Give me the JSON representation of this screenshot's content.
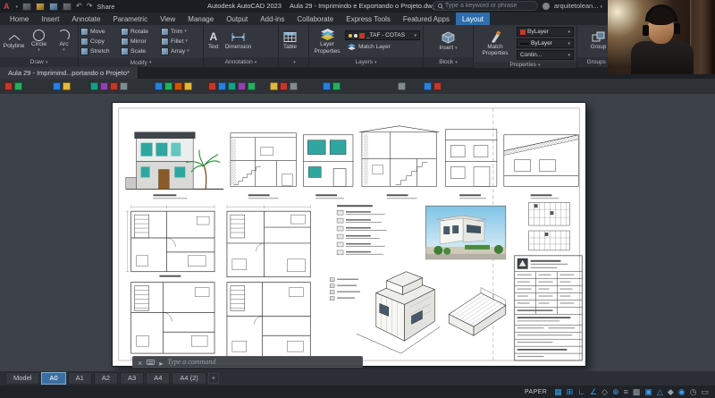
{
  "titlebar": {
    "logo": "A",
    "share": "Share",
    "app": "Autodesk AutoCAD 2023",
    "doc": "Aula 29 - Imprimindo e Exportando o Projeto.dwg",
    "search_placeholder": "Type a keyword or phrase",
    "account": "arquitetolean..."
  },
  "ribbon": {
    "tabs": [
      {
        "label": "Home"
      },
      {
        "label": "Insert"
      },
      {
        "label": "Annotate"
      },
      {
        "label": "Parametric"
      },
      {
        "label": "View"
      },
      {
        "label": "Manage"
      },
      {
        "label": "Output"
      },
      {
        "label": "Add-ins"
      },
      {
        "label": "Collaborate"
      },
      {
        "label": "Express Tools"
      },
      {
        "label": "Featured Apps"
      },
      {
        "label": "Layout",
        "active": true
      }
    ],
    "draw": {
      "label": "Draw",
      "tools": [
        {
          "label": "Polyline",
          "icon": "polyline"
        },
        {
          "label": "Circle",
          "icon": "circle",
          "chev": "▾"
        },
        {
          "label": "Arc",
          "icon": "arc",
          "chev": "▾"
        }
      ]
    },
    "modify": {
      "label": "Modify",
      "tools": [
        {
          "label": "Move"
        },
        {
          "label": "Rotate"
        },
        {
          "label": "Trim",
          "chev": "▾"
        },
        {
          "label": "Copy"
        },
        {
          "label": "Mirror"
        },
        {
          "label": "Fillet",
          "chev": "▾"
        },
        {
          "label": "Stretch"
        },
        {
          "label": "Scale"
        },
        {
          "label": "Array",
          "chev": "▾"
        }
      ]
    },
    "annotation": {
      "label": "Annotation",
      "text": "Text",
      "dimension": "Dimension"
    },
    "table": {
      "label": "",
      "button": "Table"
    },
    "layers": {
      "label": "Layers",
      "layer_properties": "Layer Properties",
      "current_layer": "_TAF - COTAS",
      "match_layer": "Match Layer"
    },
    "block": {
      "label": "Block",
      "insert": "Insert"
    },
    "properties": {
      "label": "Properties",
      "match_properties": "Match Properties",
      "color": "ByLayer",
      "lineweight": "ByLayer",
      "linetype": "Contin..."
    },
    "groups": {
      "label": "Groups",
      "group": "Group"
    }
  },
  "file_tabs": [
    {
      "label": "Aula 29 - Imprimind...portando o Projeto*",
      "active": true
    }
  ],
  "canvas": {
    "command_placeholder": "Type a command"
  },
  "layout_tabs": [
    {
      "label": "Model"
    },
    {
      "label": "A0",
      "active": true
    },
    {
      "label": "A1"
    },
    {
      "label": "A2"
    },
    {
      "label": "A3"
    },
    {
      "label": "A4"
    },
    {
      "label": "A4 (2)"
    }
  ],
  "new_layout": "+",
  "status_bar": {
    "space": "PAPER",
    "icons": [
      {
        "name": "grid-icon",
        "glyph": "▦",
        "color": "#3d9fe8"
      },
      {
        "name": "snap-icon",
        "glyph": "⊞",
        "color": "#3d9fe8"
      },
      {
        "name": "ortho-icon",
        "glyph": "∟",
        "color": "#9aa3ab"
      },
      {
        "name": "polar-tracking-icon",
        "glyph": "∠",
        "color": "#3d9fe8"
      },
      {
        "name": "isodraft-icon",
        "glyph": "◇",
        "color": "#9aa3ab"
      },
      {
        "name": "osnap-icon",
        "glyph": "⊕",
        "color": "#3d9fe8"
      },
      {
        "name": "lineweight-icon",
        "glyph": "≡",
        "color": "#9aa3ab"
      },
      {
        "name": "transparency-icon",
        "glyph": "▩",
        "color": "#9aa3ab"
      },
      {
        "name": "dynamic-input-icon",
        "glyph": "▣",
        "color": "#3d9fe8"
      },
      {
        "name": "annotation-scale-icon",
        "glyph": "△",
        "color": "#3d9fe8"
      },
      {
        "name": "workspace-icon",
        "glyph": "◆",
        "color": "#9aa3ab"
      },
      {
        "name": "annotation-monitor-icon",
        "glyph": "◉",
        "color": "#3d9fe8"
      },
      {
        "name": "clock-icon",
        "glyph": "◷",
        "color": "#9aa3ab"
      },
      {
        "name": "clean-screen-icon",
        "glyph": "▭",
        "color": "#9aa3ab"
      }
    ]
  }
}
